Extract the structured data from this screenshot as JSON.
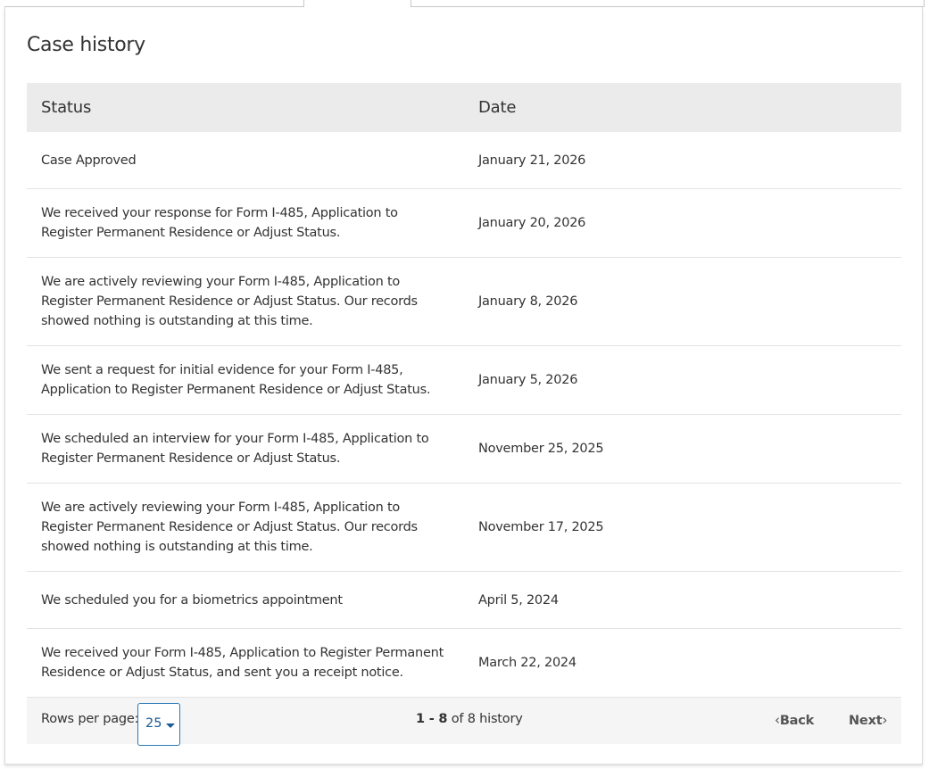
{
  "section": {
    "title": "Case history"
  },
  "table": {
    "headers": {
      "status": "Status",
      "date": "Date"
    },
    "rows": [
      {
        "status": "Case Approved",
        "date": "January 21, 2026"
      },
      {
        "status": "We received your response for Form I-485, Application to Register Permanent Residence or Adjust Status.",
        "date": "January 20, 2026"
      },
      {
        "status": "We are actively reviewing your Form I-485, Application to Register Permanent Residence or Adjust Status. Our records showed nothing is outstanding at this time.",
        "date": "January 8, 2026"
      },
      {
        "status": "We sent a request for initial evidence for your Form I-485, Application to Register Permanent Residence or Adjust Status.",
        "date": "January 5, 2026"
      },
      {
        "status": "We scheduled an interview for your Form I-485, Application to Register Permanent Residence or Adjust Status.",
        "date": "November 25, 2025"
      },
      {
        "status": "We are actively reviewing your Form I-485, Application to Register Permanent Residence or Adjust Status. Our records showed nothing is outstanding at this time.",
        "date": "November 17, 2025"
      },
      {
        "status": "We scheduled you for a biometrics appointment",
        "date": "April 5, 2024"
      },
      {
        "status": "We received your Form I-485, Application to Register Permanent Residence or Adjust Status, and sent you a receipt notice.",
        "date": "March 22, 2024"
      }
    ]
  },
  "pagination": {
    "rows_per_page_label": "Rows per page:",
    "rows_per_page_value": "25",
    "range": "1 - 8",
    "range_suffix": "of 8 history",
    "back_label": "Back",
    "next_label": "Next"
  },
  "colors": {
    "header_bg": "#ebebeb",
    "footer_bg": "#f5f5f5",
    "select_border": "#2a7ab8",
    "select_text": "#1a5a96"
  },
  "icons": {
    "back": "chevron-left-icon",
    "next": "chevron-right-icon",
    "select": "caret-down-icon"
  }
}
